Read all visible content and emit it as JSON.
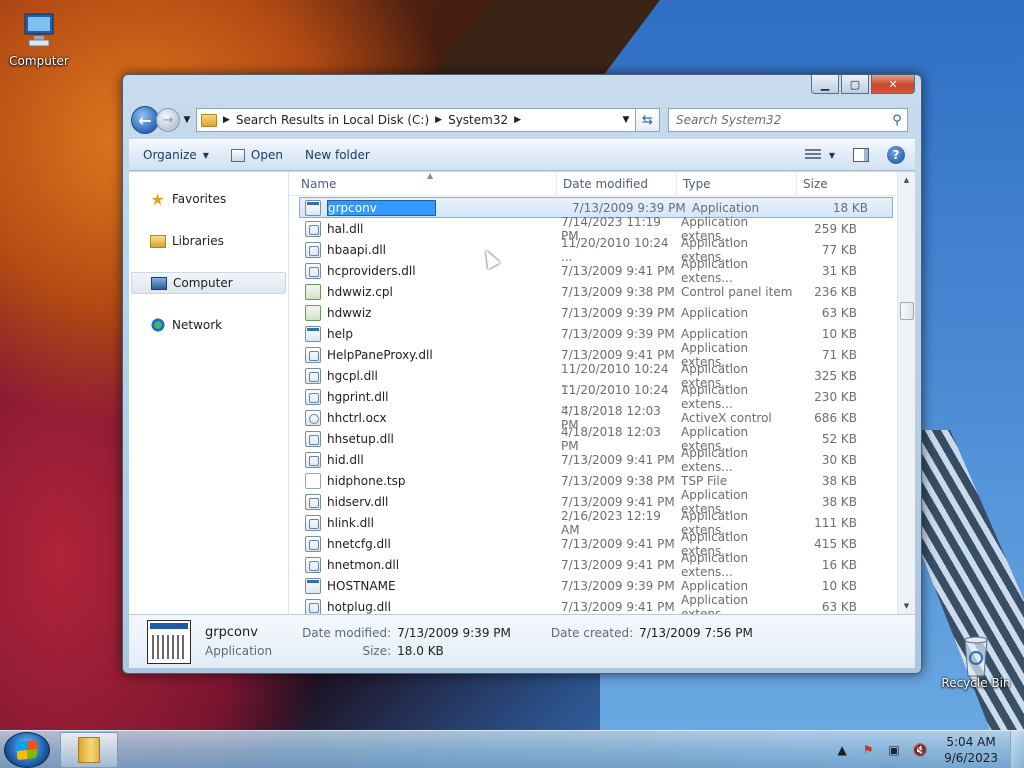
{
  "desktop": {
    "icons": [
      {
        "label": "Computer"
      },
      {
        "label": "Recycle Bin"
      }
    ]
  },
  "window": {
    "address": {
      "segments": [
        "Search Results in Local Disk (C:)",
        "System32"
      ]
    },
    "search": {
      "placeholder": "Search System32"
    },
    "toolbar": {
      "organize": "Organize",
      "open": "Open",
      "new_folder": "New folder"
    },
    "nav": {
      "items": [
        {
          "label": "Favorites",
          "icon": "star-icon"
        },
        {
          "label": "Libraries",
          "icon": "libraries-icon"
        },
        {
          "label": "Computer",
          "icon": "computer-icon",
          "selected": true
        },
        {
          "label": "Network",
          "icon": "network-icon"
        }
      ]
    },
    "columns": {
      "name": "Name",
      "date": "Date modified",
      "type": "Type",
      "size": "Size"
    },
    "files": [
      {
        "name": "grpconv",
        "date": "7/13/2009 9:39 PM",
        "type": "Application",
        "size": "18 KB",
        "icon": "app",
        "selected": true
      },
      {
        "name": "hal.dll",
        "date": "7/14/2023 11:19 PM",
        "type": "Application extens...",
        "size": "259 KB",
        "icon": "dll"
      },
      {
        "name": "hbaapi.dll",
        "date": "11/20/2010 10:24 ...",
        "type": "Application extens...",
        "size": "77 KB",
        "icon": "dll"
      },
      {
        "name": "hcproviders.dll",
        "date": "7/13/2009 9:41 PM",
        "type": "Application extens...",
        "size": "31 KB",
        "icon": "dll"
      },
      {
        "name": "hdwwiz.cpl",
        "date": "7/13/2009 9:38 PM",
        "type": "Control panel item",
        "size": "236 KB",
        "icon": "cpl"
      },
      {
        "name": "hdwwiz",
        "date": "7/13/2009 9:39 PM",
        "type": "Application",
        "size": "63 KB",
        "icon": "cpl"
      },
      {
        "name": "help",
        "date": "7/13/2009 9:39 PM",
        "type": "Application",
        "size": "10 KB",
        "icon": "app"
      },
      {
        "name": "HelpPaneProxy.dll",
        "date": "7/13/2009 9:41 PM",
        "type": "Application extens...",
        "size": "71 KB",
        "icon": "dll"
      },
      {
        "name": "hgcpl.dll",
        "date": "11/20/2010 10:24 ...",
        "type": "Application extens...",
        "size": "325 KB",
        "icon": "dll"
      },
      {
        "name": "hgprint.dll",
        "date": "11/20/2010 10:24 ...",
        "type": "Application extens...",
        "size": "230 KB",
        "icon": "dll"
      },
      {
        "name": "hhctrl.ocx",
        "date": "4/18/2018 12:03 PM",
        "type": "ActiveX control",
        "size": "686 KB",
        "icon": "ocx"
      },
      {
        "name": "hhsetup.dll",
        "date": "4/18/2018 12:03 PM",
        "type": "Application extens...",
        "size": "52 KB",
        "icon": "dll"
      },
      {
        "name": "hid.dll",
        "date": "7/13/2009 9:41 PM",
        "type": "Application extens...",
        "size": "30 KB",
        "icon": "dll"
      },
      {
        "name": "hidphone.tsp",
        "date": "7/13/2009 9:38 PM",
        "type": "TSP File",
        "size": "38 KB",
        "icon": "tsp"
      },
      {
        "name": "hidserv.dll",
        "date": "7/13/2009 9:41 PM",
        "type": "Application extens...",
        "size": "38 KB",
        "icon": "dll"
      },
      {
        "name": "hlink.dll",
        "date": "2/16/2023 12:19 AM",
        "type": "Application extens...",
        "size": "111 KB",
        "icon": "dll"
      },
      {
        "name": "hnetcfg.dll",
        "date": "7/13/2009 9:41 PM",
        "type": "Application extens...",
        "size": "415 KB",
        "icon": "dll"
      },
      {
        "name": "hnetmon.dll",
        "date": "7/13/2009 9:41 PM",
        "type": "Application extens...",
        "size": "16 KB",
        "icon": "dll"
      },
      {
        "name": "HOSTNAME",
        "date": "7/13/2009 9:39 PM",
        "type": "Application",
        "size": "10 KB",
        "icon": "app"
      },
      {
        "name": "hotplug.dll",
        "date": "7/13/2009 9:41 PM",
        "type": "Application extens...",
        "size": "63 KB",
        "icon": "dll"
      }
    ],
    "details": {
      "name": "grpconv",
      "type": "Application",
      "modified_label": "Date modified:",
      "modified": "7/13/2009 9:39 PM",
      "created_label": "Date created:",
      "created": "7/13/2009 7:56 PM",
      "size_label": "Size:",
      "size": "18.0 KB"
    }
  },
  "taskbar": {
    "time": "5:04 AM",
    "date": "9/6/2023"
  }
}
